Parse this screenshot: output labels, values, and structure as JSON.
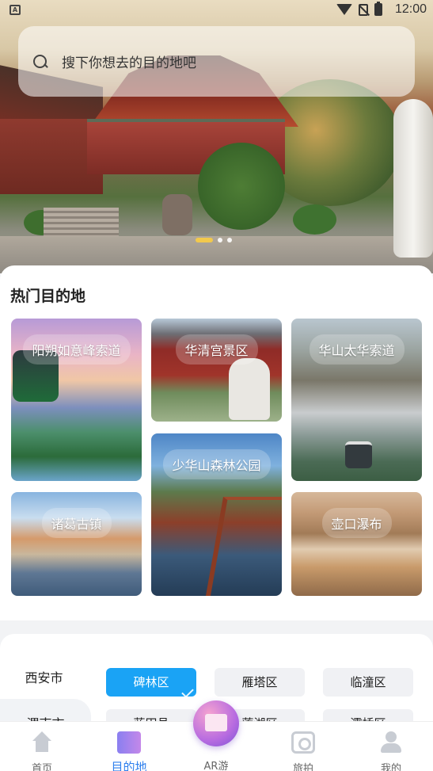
{
  "status_bar": {
    "time": "12:00",
    "notification_icon": "A"
  },
  "search": {
    "placeholder": "搜下你想去的目的地吧"
  },
  "banner": {
    "total_slides": 3,
    "active_slide": 1
  },
  "hot_destinations": {
    "title": "热门目的地",
    "items": [
      {
        "name": "阳朔如意峰索道"
      },
      {
        "name": "华清宫景区"
      },
      {
        "name": "华山太华索道"
      },
      {
        "name": "少华山森林公园"
      },
      {
        "name": "诸葛古镇"
      },
      {
        "name": "壶口瀑布"
      }
    ]
  },
  "city_selector": {
    "cities": [
      "西安市",
      "渭南市"
    ],
    "selected_city": "西安市",
    "districts": [
      "碑林区",
      "雁塔区",
      "临潼区",
      "蓝田县",
      "莲湖区",
      "灞桥区"
    ],
    "selected_district": "碑林区"
  },
  "bottom_nav": {
    "items": [
      {
        "label": "首页",
        "icon": "home-icon"
      },
      {
        "label": "目的地",
        "icon": "destination-icon",
        "active": true
      },
      {
        "label": "AR游",
        "icon": "ar-icon"
      },
      {
        "label": "旅拍",
        "icon": "camera-icon"
      },
      {
        "label": "我的",
        "icon": "user-icon"
      }
    ]
  },
  "colors": {
    "accent": "#1aa3f5",
    "nav_active": "#2f80ed",
    "dot_active": "#f2c94c"
  }
}
